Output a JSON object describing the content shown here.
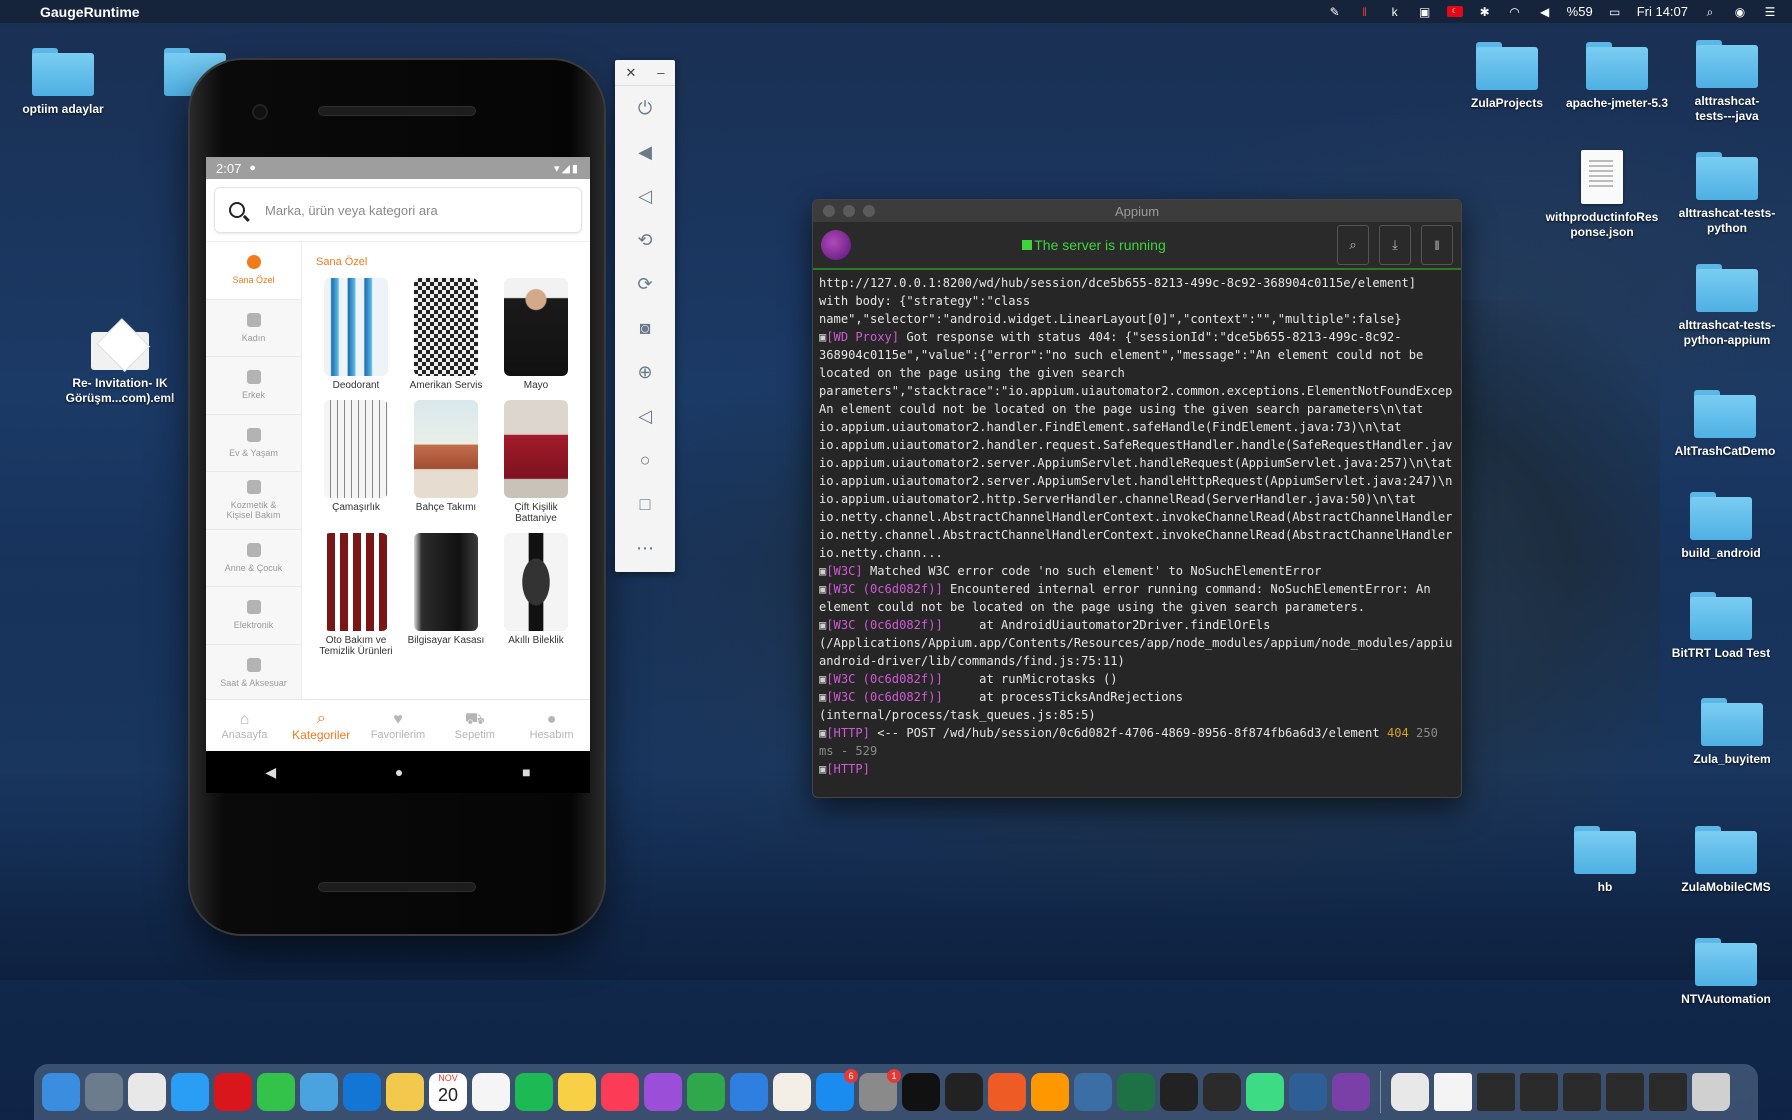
{
  "menubar": {
    "app_name": "GaugeRuntime",
    "battery": "%59",
    "clock": "Fri 14:07"
  },
  "desktop": {
    "left_icons": [
      {
        "label": "optiim adaylar"
      },
      {
        "label": "Re- Invitation- IK Görüşm...com).eml"
      }
    ],
    "right_icons": [
      {
        "label": "ZulaProjects"
      },
      {
        "label": "apache-jmeter-5.3"
      },
      {
        "label": "alttrashcat-tests---java"
      },
      {
        "label": "withproductinfoResponse.json"
      },
      {
        "label": "alttrashcat-tests-python"
      },
      {
        "label": "alttrashcat-tests-python-appium"
      },
      {
        "label": "AltTrashCatDemo"
      },
      {
        "label": "build_android"
      },
      {
        "label": "BitTRT Load Test"
      },
      {
        "label": "Zula_buyitem"
      },
      {
        "label": "hb"
      },
      {
        "label": "ZulaMobileCMS"
      },
      {
        "label": "NTVAutomation"
      }
    ]
  },
  "phone": {
    "time": "2:07",
    "search_placeholder": "Marka, ürün veya kategori ara",
    "sidebar": [
      {
        "label": "Sana Özel",
        "active": true
      },
      {
        "label": "Kadın"
      },
      {
        "label": "Erkek"
      },
      {
        "label": "Ev & Yaşam"
      },
      {
        "label": "Kozmetik & Kişisel Bakım"
      },
      {
        "label": "Anne & Çocuk"
      },
      {
        "label": "Elektronik"
      },
      {
        "label": "Saat & Aksesuar"
      }
    ],
    "section_title": "Sana Özel",
    "products": [
      {
        "label": "Deodorant"
      },
      {
        "label": "Amerikan Servis"
      },
      {
        "label": "Mayo"
      },
      {
        "label": "Çamaşırlık"
      },
      {
        "label": "Bahçe Takımı"
      },
      {
        "label": "Çift Kişilik Battaniye"
      },
      {
        "label": "Oto Bakım ve Temizlik Ürünleri"
      },
      {
        "label": "Bilgisayar Kasası"
      },
      {
        "label": "Akıllı Bileklik"
      }
    ],
    "tabs": [
      {
        "label": "Anasayfa"
      },
      {
        "label": "Kategoriler",
        "active": true
      },
      {
        "label": "Favorilerim"
      },
      {
        "label": "Sepetim"
      },
      {
        "label": "Hesabım"
      }
    ]
  },
  "appium": {
    "title": "Appium",
    "status": "The server is running",
    "log": [
      {
        "text": "http://127.0.0.1:8200/wd/hub/session/dce5b655-8213-499c-8c92-368904c0115e/element]"
      },
      {
        "text": "with body: {\"strategy\":\"class"
      },
      {
        "text": "name\",\"selector\":\"android.widget.LinearLayout[0]\",\"context\":\"\",\"multiple\":false}"
      },
      {
        "tag": "[WD Proxy]",
        "text": " Got response with status 404: {\"sessionId\":\"dce5b655-8213-499c-8c92-"
      },
      {
        "text": "368904c0115e\",\"value\":{\"error\":\"no such element\",\"message\":\"An element could not be"
      },
      {
        "text": "located on the page using the given search"
      },
      {
        "text": "parameters\",\"stacktrace\":\"io.appium.uiautomator2.common.exceptions.ElementNotFoundExcep"
      },
      {
        "text": "An element could not be located on the page using the given search parameters\\n\\tat"
      },
      {
        "text": "io.appium.uiautomator2.handler.FindElement.safeHandle(FindElement.java:73)\\n\\tat"
      },
      {
        "text": "io.appium.uiautomator2.handler.request.SafeRequestHandler.handle(SafeRequestHandler.java"
      },
      {
        "text": "io.appium.uiautomator2.server.AppiumServlet.handleRequest(AppiumServlet.java:257)\\n\\tat"
      },
      {
        "text": "io.appium.uiautomator2.server.AppiumServlet.handleHttpRequest(AppiumServlet.java:247)\\n"
      },
      {
        "text": "io.appium.uiautomator2.http.ServerHandler.channelRead(ServerHandler.java:50)\\n\\tat"
      },
      {
        "text": "io.netty.channel.AbstractChannelHandlerContext.invokeChannelRead(AbstractChannelHandler"
      },
      {
        "text": "io.netty.channel.AbstractChannelHandlerContext.invokeChannelRead(AbstractChannelHandler"
      },
      {
        "text": "io.netty.chann..."
      },
      {
        "tag": "[W3C]",
        "text": " Matched W3C error code 'no such element' to NoSuchElementError"
      },
      {
        "tag": "[W3C (0c6d082f)]",
        "text": " Encountered internal error running command: NoSuchElementError: An"
      },
      {
        "text": "element could not be located on the page using the given search parameters."
      },
      {
        "tag": "[W3C (0c6d082f)]",
        "text": "     at AndroidUiautomator2Driver.findElOrEls"
      },
      {
        "text": "(/Applications/Appium.app/Contents/Resources/app/node_modules/appium/node_modules/appiu"
      },
      {
        "text": "android-driver/lib/commands/find.js:75:11)"
      },
      {
        "tag": "[W3C (0c6d082f)]",
        "text": "     at runMicrotasks ()"
      },
      {
        "tag": "[W3C (0c6d082f)]",
        "text": "     at processTicksAndRejections"
      },
      {
        "text": "(internal/process/task_queues.js:85:5)"
      },
      {
        "tag": "[HTTP]",
        "text": " <-- POST /wd/hub/session/0c6d082f-4706-4869-8956-8f874fb6a6d3/element ",
        "code": "404",
        "extra": " 250"
      },
      {
        "text": "ms - 529",
        "grey": true
      },
      {
        "tag": "[HTTP]",
        "text": ""
      }
    ]
  },
  "dock": {
    "calendar_month": "NOV",
    "calendar_day": "20",
    "appstore_badge": "6",
    "settings_badge": "1",
    "apps": [
      {
        "name": "finder",
        "color": "#3b8de0"
      },
      {
        "name": "launchpad",
        "color": "#6d7c8c"
      },
      {
        "name": "chrome",
        "color": "#e8e8e8"
      },
      {
        "name": "safari",
        "color": "#2a9df4"
      },
      {
        "name": "opera",
        "color": "#d9161c"
      },
      {
        "name": "facetime",
        "color": "#33c24a"
      },
      {
        "name": "cyberduck",
        "color": "#4aa3df"
      },
      {
        "name": "outlook",
        "color": "#1476d4"
      },
      {
        "name": "photos",
        "color": "#f2c94c"
      },
      {
        "name": "calendar",
        "color": "#ffffff"
      },
      {
        "name": "reminders",
        "color": "#f5f5f5"
      },
      {
        "name": "spotify",
        "color": "#1db954"
      },
      {
        "name": "notes",
        "color": "#f7d046"
      },
      {
        "name": "music",
        "color": "#fa3c56"
      },
      {
        "name": "podcasts",
        "color": "#9b4fd8"
      },
      {
        "name": "numbers",
        "color": "#2ea84a"
      },
      {
        "name": "keynote",
        "color": "#2f7fe0"
      },
      {
        "name": "textedit",
        "color": "#f3efe6"
      },
      {
        "name": "appstore",
        "color": "#1a8cf0"
      },
      {
        "name": "system-preferences",
        "color": "#8a8a8a"
      },
      {
        "name": "intellij",
        "color": "#111111"
      },
      {
        "name": "unity",
        "color": "#222222"
      },
      {
        "name": "postman",
        "color": "#ef5b25"
      },
      {
        "name": "sublime",
        "color": "#ff9800"
      },
      {
        "name": "simulator",
        "color": "#3a6ea5"
      },
      {
        "name": "excel",
        "color": "#1e7145"
      },
      {
        "name": "terminal",
        "color": "#222222"
      },
      {
        "name": "activity-monitor",
        "color": "#2b2b2b"
      },
      {
        "name": "android-studio",
        "color": "#3ddc84"
      },
      {
        "name": "sourcetree",
        "color": "#2d5f96"
      },
      {
        "name": "appium",
        "color": "#7b3fa8"
      },
      {
        "name": "java",
        "color": "#e8e8e8"
      }
    ],
    "trash_color": "#d0d0d0"
  }
}
